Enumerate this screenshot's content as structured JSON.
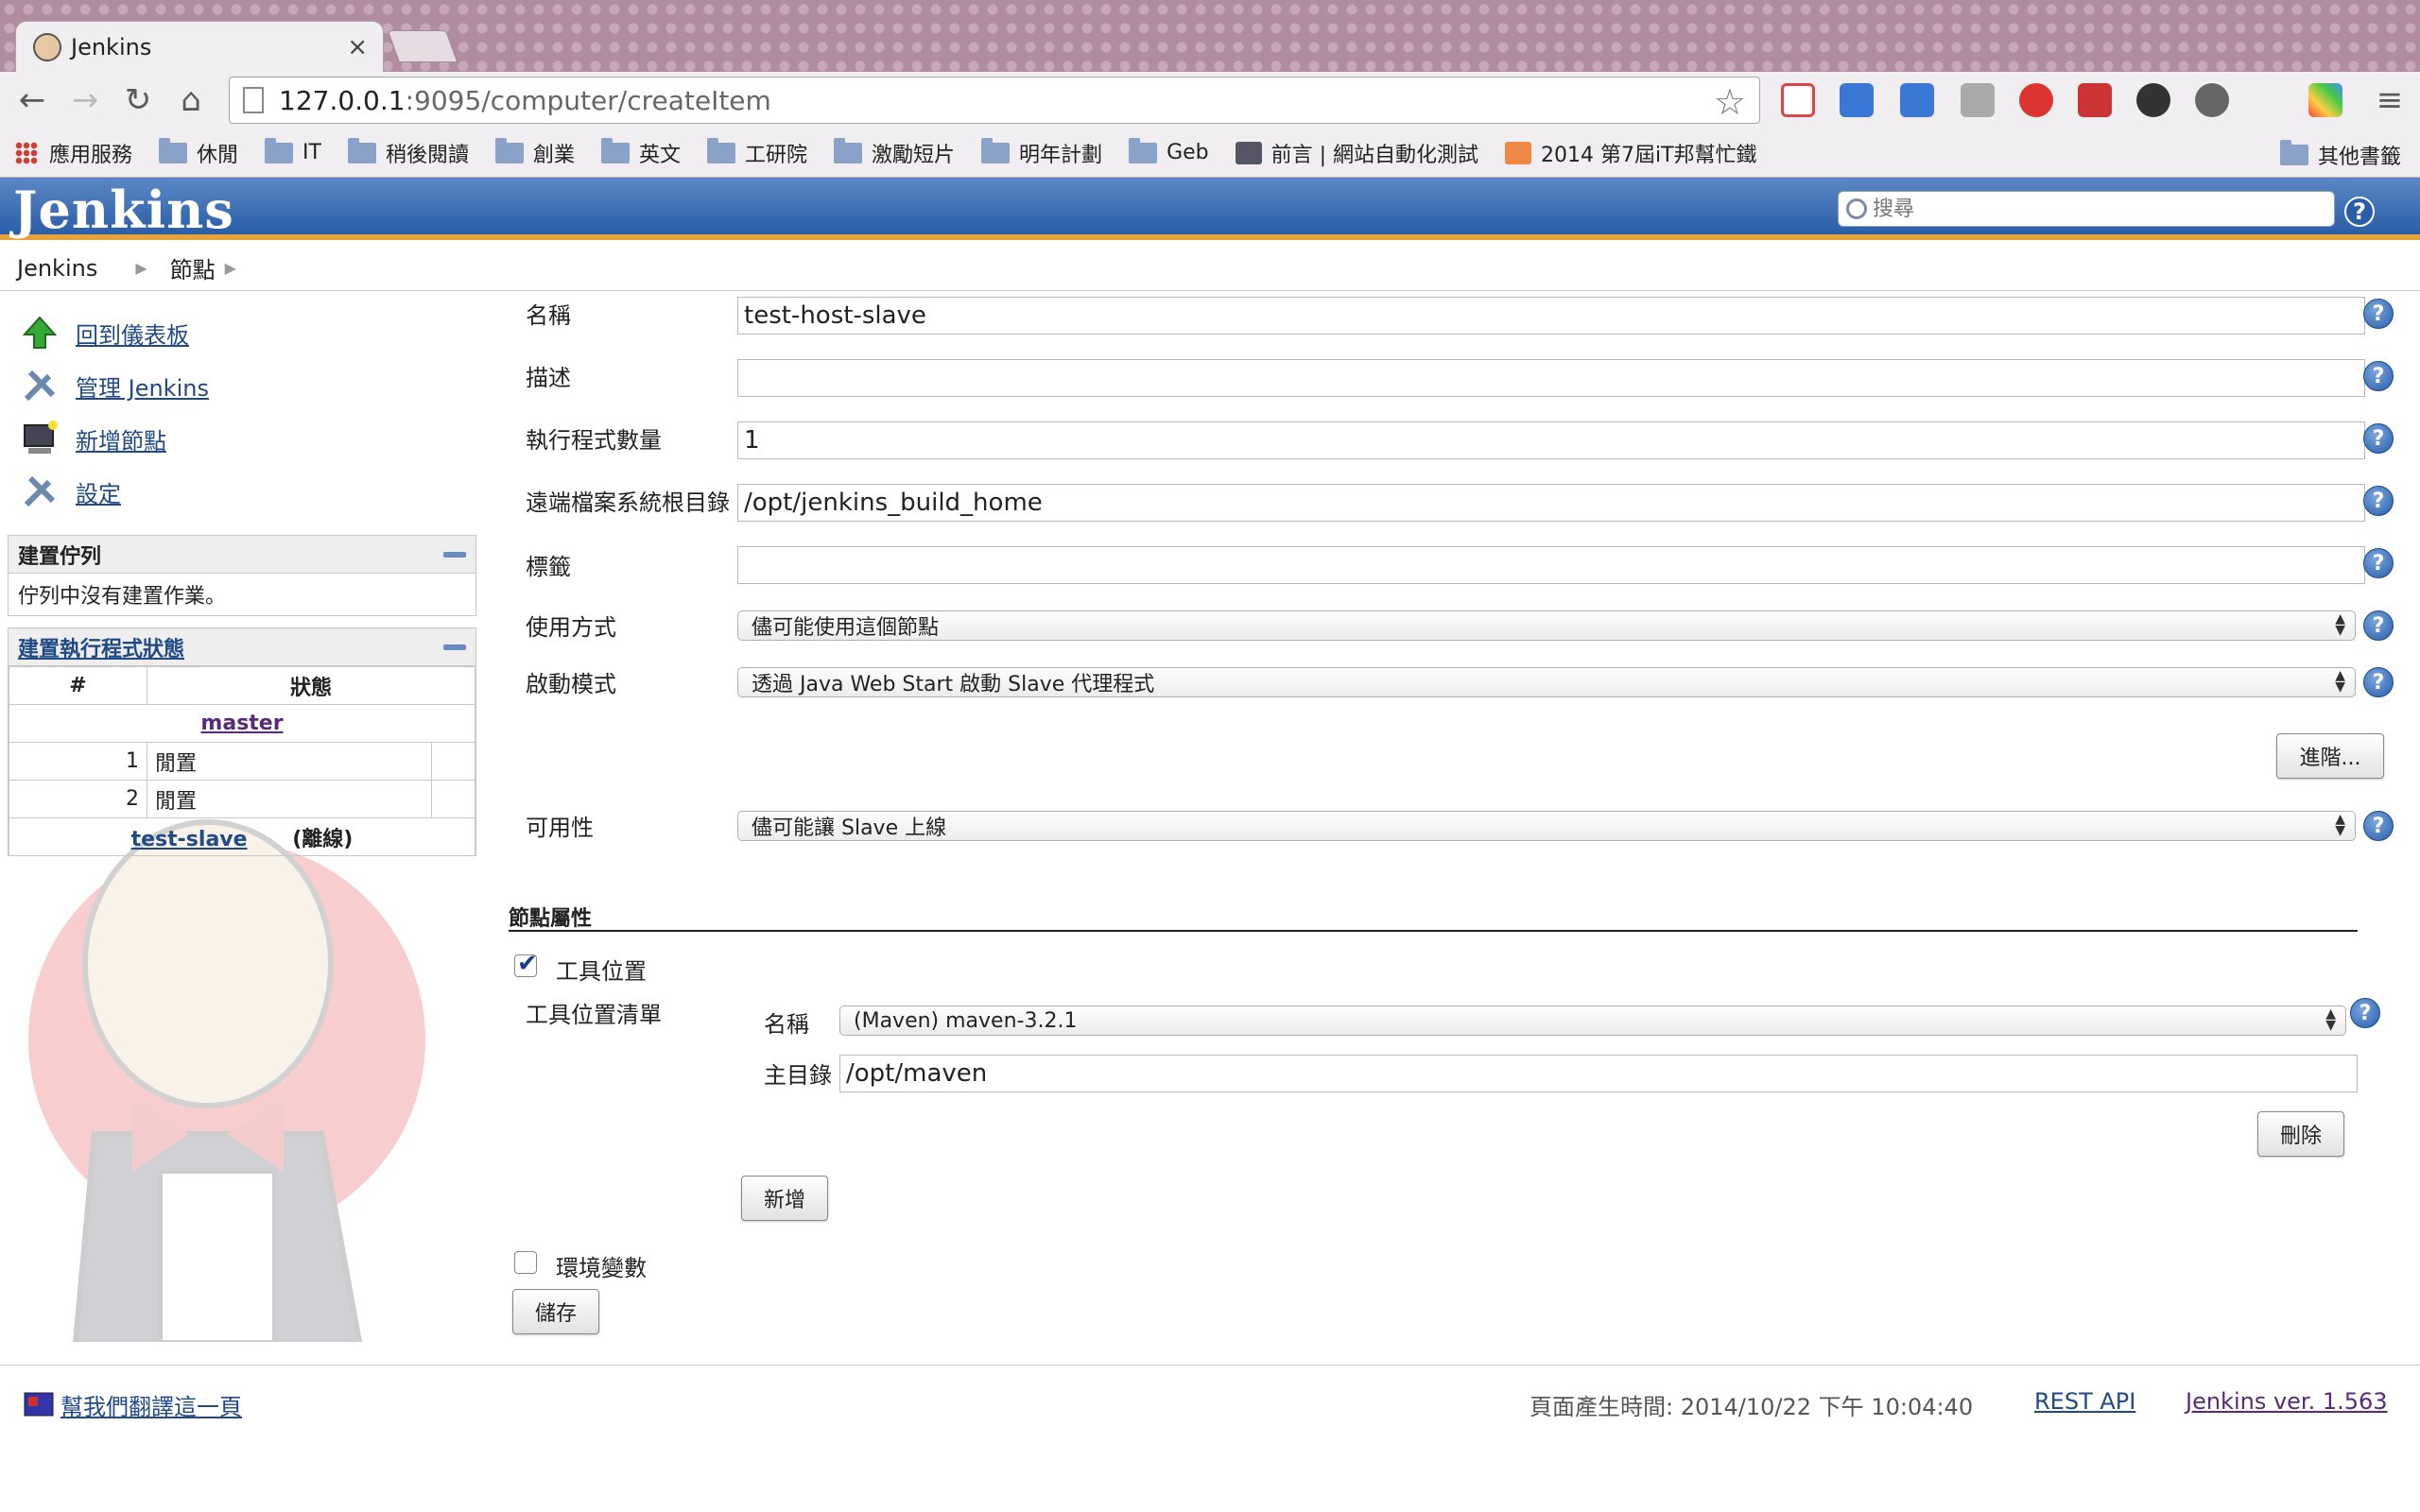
{
  "browser": {
    "tab_title": "Jenkins",
    "url_host": "127.0.0.1",
    "url_rest": ":9095/computer/createItem",
    "bookmarks": [
      {
        "label": "應用服務",
        "icon": "apps-grid-icon"
      },
      {
        "label": "休閒",
        "icon": "folder-icon"
      },
      {
        "label": "IT",
        "icon": "folder-icon"
      },
      {
        "label": "稍後閱讀",
        "icon": "folder-icon"
      },
      {
        "label": "創業",
        "icon": "folder-icon"
      },
      {
        "label": "英文",
        "icon": "folder-icon"
      },
      {
        "label": "工研院",
        "icon": "folder-icon"
      },
      {
        "label": "激勵短片",
        "icon": "folder-icon"
      },
      {
        "label": "明年計劃",
        "icon": "folder-icon"
      },
      {
        "label": "Geb",
        "icon": "folder-icon"
      },
      {
        "label": "前言 | 網站自動化測試",
        "icon": "book-icon"
      },
      {
        "label": "2014 第7屆iT邦幫忙鐵",
        "icon": "ithome-icon"
      }
    ],
    "other_bookmarks": "其他書籤"
  },
  "header": {
    "logo": "Jenkins",
    "search_placeholder": "搜尋"
  },
  "breadcrumb": {
    "root": "Jenkins",
    "nodes": "節點"
  },
  "sidebar": {
    "links": {
      "dashboard": "回到儀表板",
      "manage": "管理 Jenkins",
      "new_node": "新增節點",
      "settings": "設定"
    },
    "queue": {
      "title": "建置佇列",
      "empty": "佇列中沒有建置作業。"
    },
    "executors": {
      "title": "建置執行程式狀態",
      "col_num": "#",
      "col_status": "狀態",
      "master": "master",
      "rows": [
        {
          "num": "1",
          "status": "閒置"
        },
        {
          "num": "2",
          "status": "閒置"
        }
      ],
      "slave_name": "test-slave",
      "slave_state": "(離線)"
    }
  },
  "form": {
    "name_label": "名稱",
    "name_value": "test-host-slave",
    "desc_label": "描述",
    "desc_value": "",
    "executors_label": "執行程式數量",
    "executors_value": "1",
    "remote_fs_label": "遠端檔案系統根目錄",
    "remote_fs_value": "/opt/jenkins_build_home",
    "labels_label": "標籤",
    "labels_value": "",
    "usage_label": "使用方式",
    "usage_value": "儘可能使用這個節點",
    "launch_label": "啟動模式",
    "launch_value": "透過 Java Web Start 啟動 Slave 代理程式",
    "advanced_button": "進階...",
    "availability_label": "可用性",
    "availability_value": "儘可能讓 Slave 上線",
    "node_props_title": "節點屬性",
    "tool_locations_label": "工具位置",
    "tool_locations_checked": true,
    "tool_list_label": "工具位置清單",
    "tool_name_label": "名稱",
    "tool_name_value": "(Maven) maven-3.2.1",
    "tool_home_label": "主目錄",
    "tool_home_value": "/opt/maven",
    "delete_button": "刪除",
    "add_button": "新增",
    "env_vars_label": "環境變數",
    "env_vars_checked": false,
    "save_button": "儲存"
  },
  "footer": {
    "translate_link": "幫我們翻譯這一頁",
    "generated": "頁面產生時間: 2014/10/22 下午 10:04:40",
    "rest_api": "REST API",
    "version": "Jenkins ver. 1.563"
  }
}
